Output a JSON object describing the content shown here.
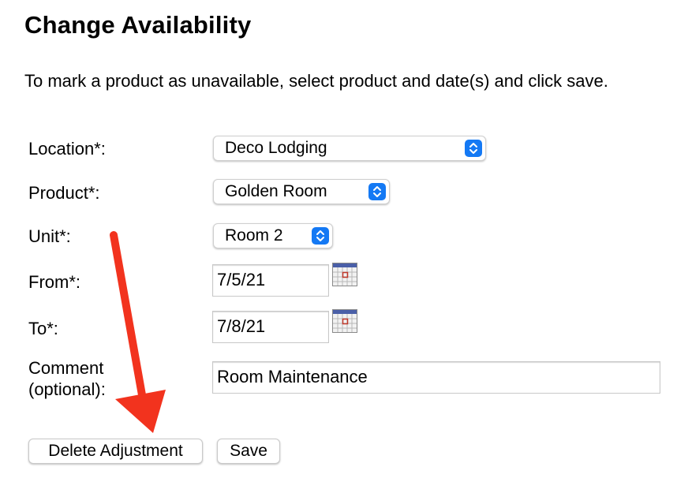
{
  "header": {
    "title": "Change Availability"
  },
  "intro": "To mark a product as unavailable, select product and date(s) and click save.",
  "form": {
    "location": {
      "label": "Location*:",
      "value": "Deco Lodging"
    },
    "product": {
      "label": "Product*:",
      "value": "Golden Room"
    },
    "unit": {
      "label": "Unit*:",
      "value": "Room 2"
    },
    "from": {
      "label": "From*:",
      "value": "7/5/21"
    },
    "to": {
      "label": "To*:",
      "value": "7/8/21"
    },
    "comment": {
      "label_line1": "Comment",
      "label_line2": "(optional):",
      "value": "Room Maintenance"
    }
  },
  "buttons": {
    "delete_label": "Delete Adjustment",
    "save_label": "Save"
  },
  "icons": {
    "select_chevron": "up-down-chevron-icon",
    "calendar": "calendar-icon",
    "annotation": "red-arrow-icon"
  },
  "colors": {
    "select_accent": "#1479f4",
    "annotation_arrow": "#f2331e"
  }
}
